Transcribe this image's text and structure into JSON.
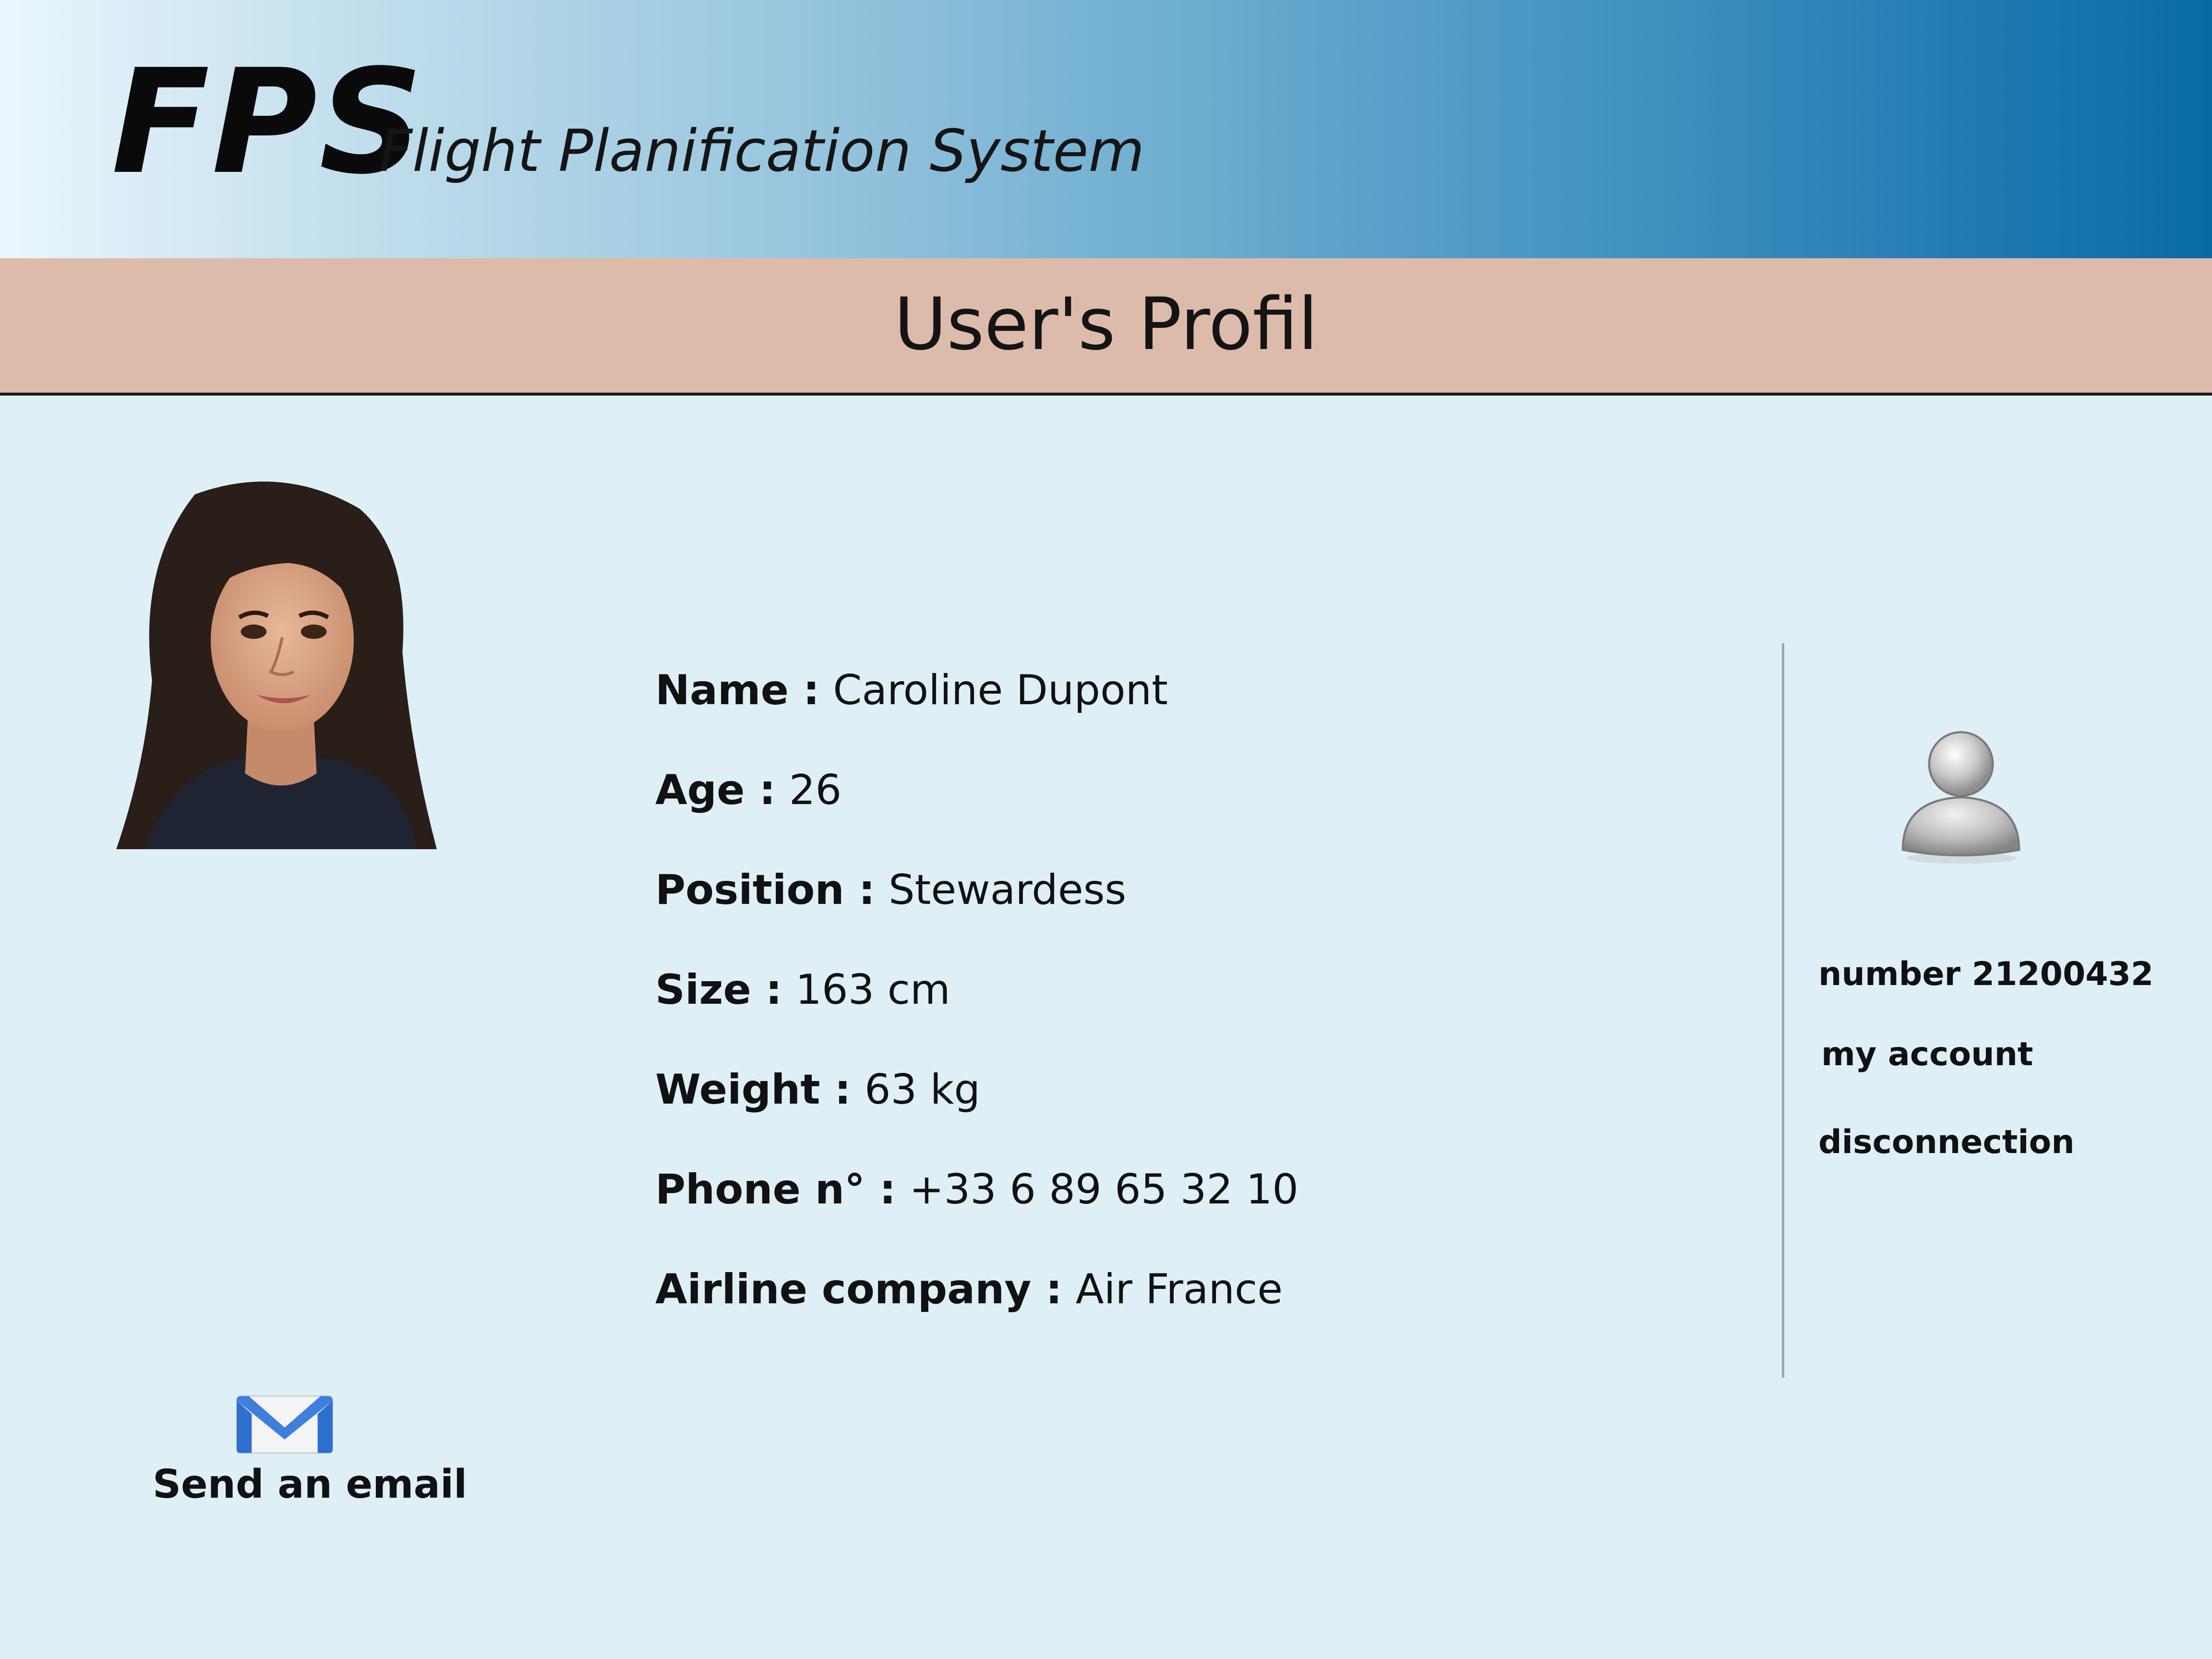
{
  "header": {
    "logo": "FPS",
    "app_name": "Flight Planification System"
  },
  "page_title": "User's Profil",
  "profile": {
    "fields": [
      {
        "label": "Name :",
        "value": "Caroline Dupont"
      },
      {
        "label": "Age :",
        "value": "26"
      },
      {
        "label": "Position :",
        "value": "Stewardess"
      },
      {
        "label": "Size :",
        "value": "163 cm"
      },
      {
        "label": "Weight :",
        "value": "63 kg"
      },
      {
        "label": "Phone n° :",
        "value": "+33 6 89 65 32 10"
      },
      {
        "label": "Airline company :",
        "value": "Air France"
      }
    ]
  },
  "side_panel": {
    "icon": "user-avatar-icon",
    "account_number": "number 21200432",
    "my_account": "my account",
    "disconnection": "disconnection"
  },
  "email": {
    "icon": "mail-icon",
    "label": "Send an email"
  },
  "colors": {
    "background": "#def0f6",
    "title_bar": "#ddbbab",
    "header_gradient_start": "#eaf6fc",
    "header_gradient_end": "#0a6aa5"
  }
}
